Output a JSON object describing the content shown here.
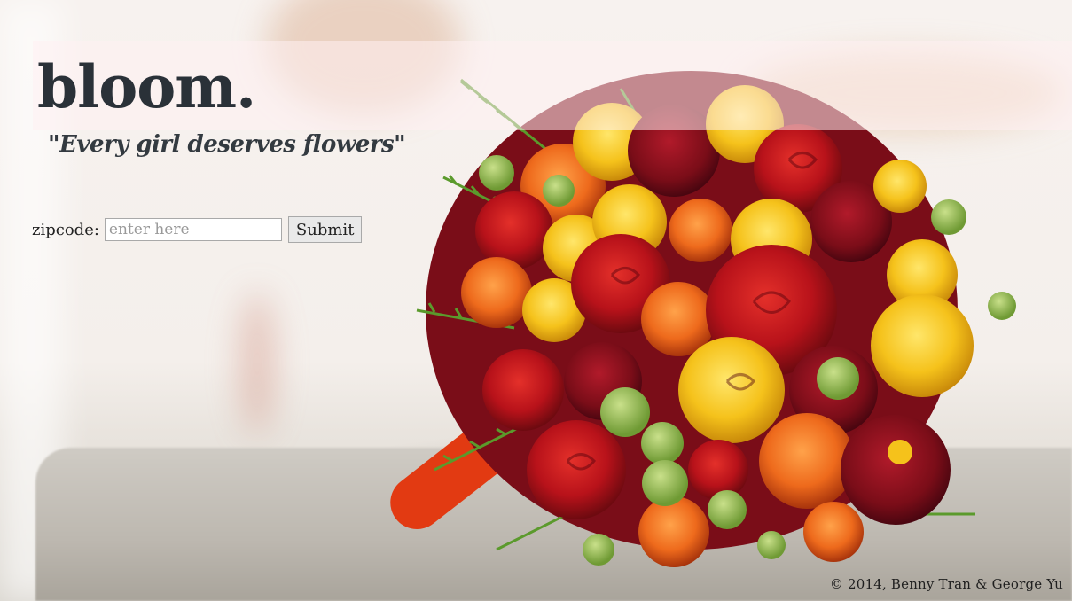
{
  "header": {
    "logo": "bloom.",
    "tagline": "\"Every girl deserves flowers\""
  },
  "form": {
    "label": "zipcode:",
    "input_placeholder": "enter here",
    "input_value": "",
    "submit_label": "Submit"
  },
  "footer": {
    "copyright": "© 2014, Benny Tran & George Yu"
  },
  "colors": {
    "logo": "#2a3138",
    "rose_red": "#b8121a",
    "rose_yellow": "#f5c21b",
    "rose_orange": "#ee6a1c",
    "fern_green": "#5b9a2c"
  },
  "background": {
    "subject": "flower-bouquet-photo"
  }
}
